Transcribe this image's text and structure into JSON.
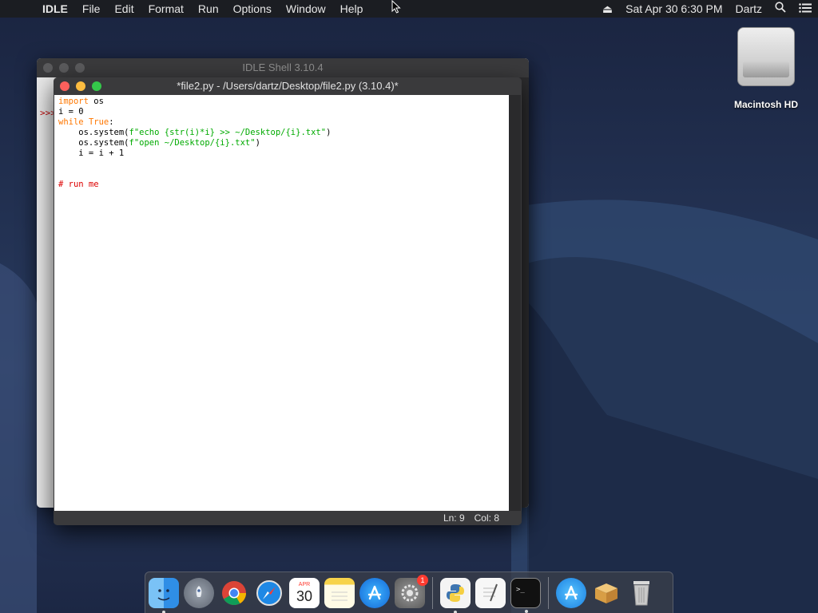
{
  "menubar": {
    "app_name": "IDLE",
    "items": [
      "File",
      "Edit",
      "Format",
      "Run",
      "Options",
      "Window",
      "Help"
    ],
    "datetime": "Sat Apr 30  6:30 PM",
    "user": "Dartz"
  },
  "desktop": {
    "drive_label": "Macintosh HD"
  },
  "shell_window": {
    "title": "IDLE Shell 3.10.4",
    "prompt": ">>>"
  },
  "editor_window": {
    "title": "*file2.py - /Users/dartz/Desktop/file2.py (3.10.4)*",
    "status_line": "Ln: 9",
    "status_col": "Col: 8"
  },
  "code": {
    "l1_kw": "import",
    "l1_rest": " os",
    "l2": "i = 0",
    "l3_kw": "while",
    "l3_sp": " ",
    "l3_kw2": "True",
    "l3_rest": ":",
    "l4_pre": "    os.system(",
    "l4_str": "f\"echo {str(i)*i} >> ~/Desktop/{i}.txt\"",
    "l4_post": ")",
    "l5_pre": "    os.system(",
    "l5_str": "f\"open ~/Desktop/{i}.txt\"",
    "l5_post": ")",
    "l6": "    i = i + 1",
    "l9_comment": "# run me"
  },
  "dock": {
    "calendar_month": "APR",
    "calendar_day": "30",
    "sys_prefs_badge": "1"
  },
  "colors": {
    "keyword": "#ff7700",
    "string": "#00aa00",
    "comment": "#dd0000"
  }
}
